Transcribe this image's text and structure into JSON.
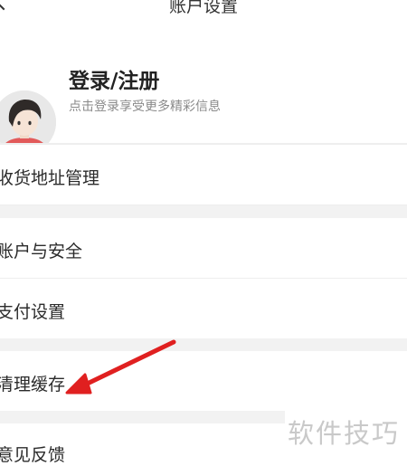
{
  "header": {
    "title": "账户设置"
  },
  "profile": {
    "title": "登录/注册",
    "subtitle": "点击登录享受更多精彩信息"
  },
  "menu": [
    {
      "label": "收货地址管理"
    },
    {
      "label": "账户与安全"
    },
    {
      "label": "支付设置"
    },
    {
      "label": "清理缓存"
    },
    {
      "label": "意见反馈"
    }
  ],
  "watermark": "软件技巧",
  "colors": {
    "annotation_arrow": "#e02020",
    "section_gap": "#f2f2f2"
  }
}
